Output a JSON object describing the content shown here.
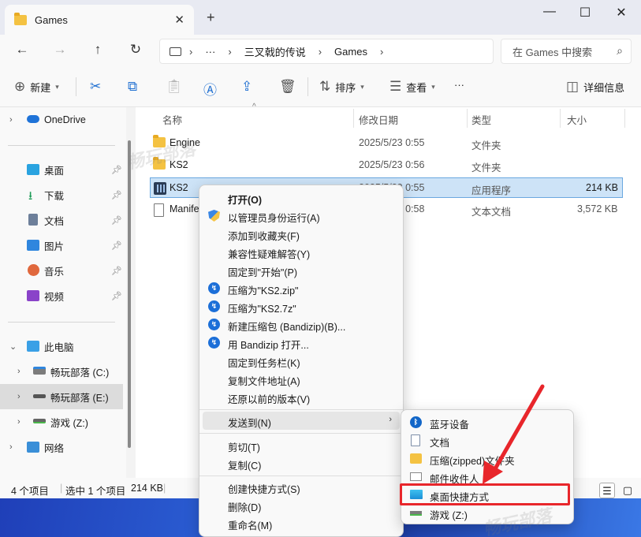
{
  "window": {
    "tab_title": "Games",
    "tab_close": "✕",
    "new_tab": "+",
    "minimize": "—",
    "maximize": "☐",
    "close": "✕"
  },
  "address": {
    "breadcrumb": [
      "三叉戟的传说",
      "Games"
    ],
    "ellipsis": "···",
    "search_placeholder": "在 Games 中搜索"
  },
  "toolbar": {
    "new_label": "新建",
    "sort_label": "排序",
    "view_label": "查看",
    "details_label": "详细信息",
    "more_label": "···"
  },
  "sidebar": {
    "items": [
      {
        "label": "OneDrive"
      },
      {
        "label": "桌面"
      },
      {
        "label": "下载"
      },
      {
        "label": "文档"
      },
      {
        "label": "图片"
      },
      {
        "label": "音乐"
      },
      {
        "label": "视频"
      },
      {
        "label": "此电脑"
      },
      {
        "label": "畅玩部落 (C:)"
      },
      {
        "label": "畅玩部落 (E:)"
      },
      {
        "label": "游戏 (Z:)"
      },
      {
        "label": "网络"
      }
    ]
  },
  "columns": {
    "name": "名称",
    "date": "修改日期",
    "type": "类型",
    "size": "大小"
  },
  "files": [
    {
      "name": "Engine",
      "date": "2025/5/23 0:55",
      "type": "文件夹",
      "size": ""
    },
    {
      "name": "KS2",
      "date": "2025/5/23 0:56",
      "type": "文件夹",
      "size": ""
    },
    {
      "name": "KS2",
      "date": "2025/5/23 0:55",
      "type": "应用程序",
      "size": "214 KB"
    },
    {
      "name": "Manife",
      "date": "2025/5/23 0:58",
      "type": "文本文档",
      "size": "3,572 KB"
    }
  ],
  "status": {
    "count": "4 个项目",
    "selected": "选中 1 个项目",
    "size": "214 KB"
  },
  "context_menu": {
    "items": [
      "打开(O)",
      "以管理员身份运行(A)",
      "添加到收藏夹(F)",
      "兼容性疑难解答(Y)",
      "固定到\"开始\"(P)",
      "压缩为\"KS2.zip\"",
      "压缩为\"KS2.7z\"",
      "新建压缩包 (Bandizip)(B)...",
      "用 Bandizip 打开...",
      "固定到任务栏(K)",
      "复制文件地址(A)",
      "还原以前的版本(V)",
      "发送到(N)",
      "剪切(T)",
      "复制(C)",
      "创建快捷方式(S)",
      "删除(D)",
      "重命名(M)"
    ]
  },
  "sendto_menu": {
    "items": [
      "蓝牙设备",
      "文档",
      "压缩(zipped)文件夹",
      "邮件收件人",
      "桌面快捷方式",
      "游戏 (Z:)"
    ]
  },
  "annotation": {
    "highlight_color": "#e8262b"
  },
  "watermark": {
    "text": "畅玩部落"
  }
}
